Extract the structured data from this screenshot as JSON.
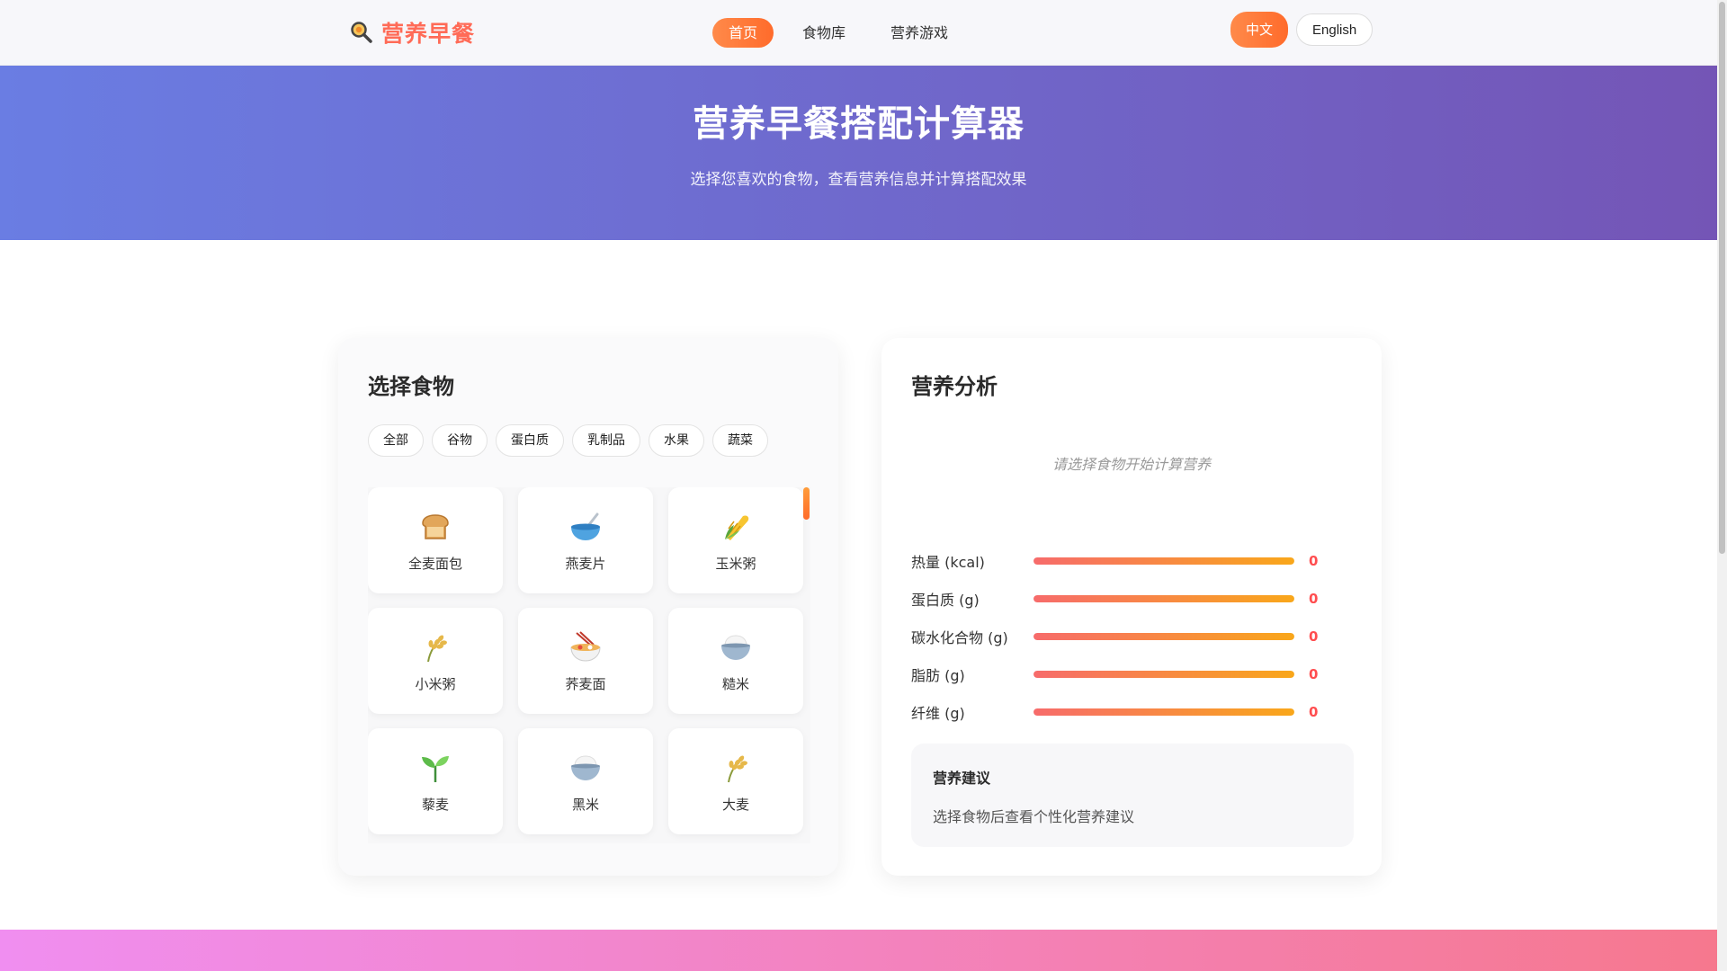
{
  "brand": {
    "name": "营养早餐",
    "icon": "magnifier-icon"
  },
  "nav": {
    "links": [
      {
        "label": "首页",
        "active": true
      },
      {
        "label": "食物库",
        "active": false
      },
      {
        "label": "营养游戏",
        "active": false
      }
    ]
  },
  "lang": {
    "zh": "中文",
    "en": "English"
  },
  "hero": {
    "title": "营养早餐搭配计算器",
    "subtitle": "选择您喜欢的食物，查看营养信息并计算搭配效果"
  },
  "food_panel": {
    "title": "选择食物",
    "filters": [
      "全部",
      "谷物",
      "蛋白质",
      "乳制品",
      "水果",
      "蔬菜"
    ],
    "foods": [
      {
        "name": "全麦面包",
        "icon": "bread-icon"
      },
      {
        "name": "燕麦片",
        "icon": "bowl-icon"
      },
      {
        "name": "玉米粥",
        "icon": "corn-icon"
      },
      {
        "name": "小米粥",
        "icon": "rice-plant-icon"
      },
      {
        "name": "荞麦面",
        "icon": "noodles-icon"
      },
      {
        "name": "糙米",
        "icon": "rice-bowl-icon"
      },
      {
        "name": "藜麦",
        "icon": "seedling-icon"
      },
      {
        "name": "黑米",
        "icon": "rice-bowl-icon"
      },
      {
        "name": "大麦",
        "icon": "rice-plant-icon"
      }
    ]
  },
  "analysis": {
    "title": "营养分析",
    "empty_hint": "请选择食物开始计算营养",
    "metrics": [
      {
        "label": "热量 (kcal)",
        "value": "0",
        "fill_percent": 100
      },
      {
        "label": "蛋白质 (g)",
        "value": "0",
        "fill_percent": 100
      },
      {
        "label": "碳水化合物 (g)",
        "value": "0",
        "fill_percent": 100
      },
      {
        "label": "脂肪 (g)",
        "value": "0",
        "fill_percent": 100
      },
      {
        "label": "纤维 (g)",
        "value": "0",
        "fill_percent": 100
      }
    ],
    "advice": {
      "title": "营养建议",
      "text": "选择食物后查看个性化营养建议"
    }
  },
  "colors": {
    "accent": "#ff6b2b",
    "brand": "#ff6b57",
    "hero_start": "#6a7de3",
    "hero_end": "#7455b6",
    "value": "#ff4d4f"
  }
}
